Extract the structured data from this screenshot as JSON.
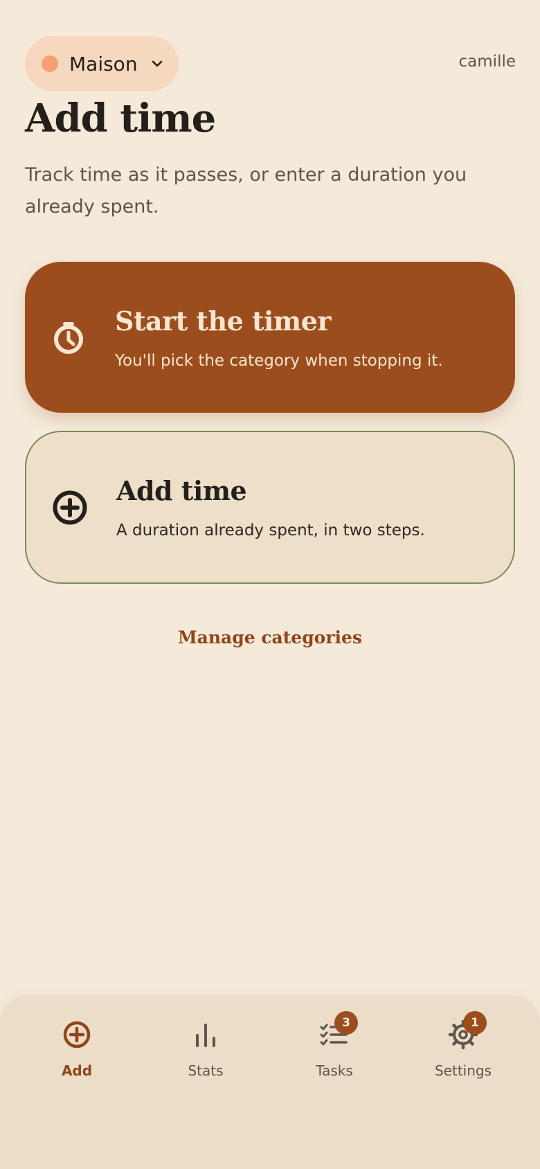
{
  "header": {
    "workspace": "Maison",
    "workspace_color": "#F4A06F",
    "user": "camille"
  },
  "page": {
    "title": "Add time",
    "subtitle": "Track time as it passes, or enter a duration you already spent."
  },
  "cards": {
    "timer": {
      "title": "Start the timer",
      "description": "You'll pick the category when stopping it.",
      "icon": "stopwatch-icon"
    },
    "manual": {
      "title": "Add time",
      "description": "A duration already spent, in two steps.",
      "icon": "plus-circle-icon"
    }
  },
  "links": {
    "manage_categories": "Manage categories"
  },
  "nav": {
    "items": [
      {
        "label": "Add",
        "icon": "plus-circle-icon",
        "active": true
      },
      {
        "label": "Stats",
        "icon": "bar-chart-icon"
      },
      {
        "label": "Tasks",
        "icon": "checklist-icon",
        "badge": "3"
      },
      {
        "label": "Settings",
        "icon": "gear-icon",
        "badge": "1"
      }
    ]
  },
  "colors": {
    "background": "#F5EAD9",
    "accent": "#9C4D1D",
    "card_outline": "#7D8A5A"
  }
}
